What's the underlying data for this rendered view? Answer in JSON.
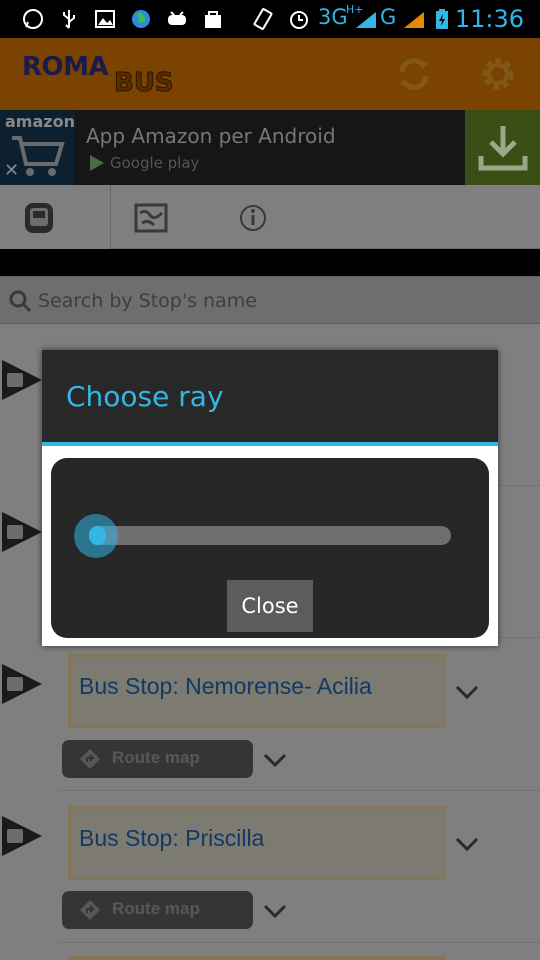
{
  "status_bar": {
    "network_3g": "3G",
    "network_hplus": "H+",
    "network_g": "G",
    "time": "11:36"
  },
  "app_bar": {
    "logo_roma": "ROMA",
    "logo_bus": "BUS",
    "refresh_icon": "refresh-icon",
    "settings_icon": "gear-icon"
  },
  "ad": {
    "brand": "amazon",
    "title": "App Amazon per Android",
    "store": "Google play"
  },
  "tabs": [
    {
      "icon": "bus-stop-icon",
      "active": true
    },
    {
      "icon": "map-icon",
      "active": false
    },
    {
      "icon": "info-icon",
      "active": false
    }
  ],
  "search": {
    "placeholder": "Search by Stop's name"
  },
  "list": {
    "items": [
      {
        "title": "Bus Stop: Nemorense- Acilia",
        "route_label": "Route map"
      },
      {
        "title": "Bus Stop: Priscilla",
        "route_label": "Route map"
      }
    ]
  },
  "dialog": {
    "title": "Choose ray",
    "slider_value_fraction": 0.02,
    "close_label": "Close"
  },
  "colors": {
    "accent": "#33b5e5",
    "app_bar": "#e58a00",
    "overlay_dim": "rgba(0,0,0,0.5)"
  }
}
